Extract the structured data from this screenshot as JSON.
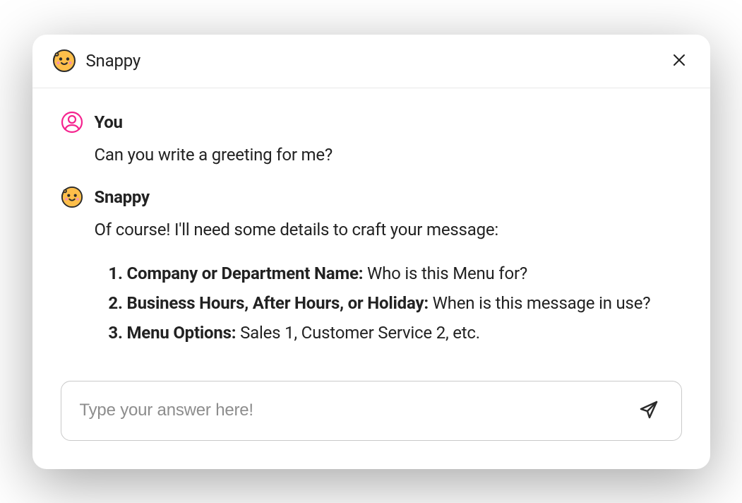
{
  "header": {
    "title": "Snappy"
  },
  "conversation": {
    "user": {
      "name": "You",
      "message": "Can you write a greeting for me?"
    },
    "bot": {
      "name": "Snappy",
      "intro": "Of course! I'll need some details to craft your message:",
      "items": [
        {
          "label": "Company or Department Name:",
          "text": " Who is this Menu for?"
        },
        {
          "label": "Business Hours, After Hours, or Holiday:",
          "text": " When is this message in use?"
        },
        {
          "label": "Menu Options:",
          "text": " Sales 1, Customer Service 2, etc."
        }
      ]
    }
  },
  "input": {
    "placeholder": "Type your answer here!"
  }
}
